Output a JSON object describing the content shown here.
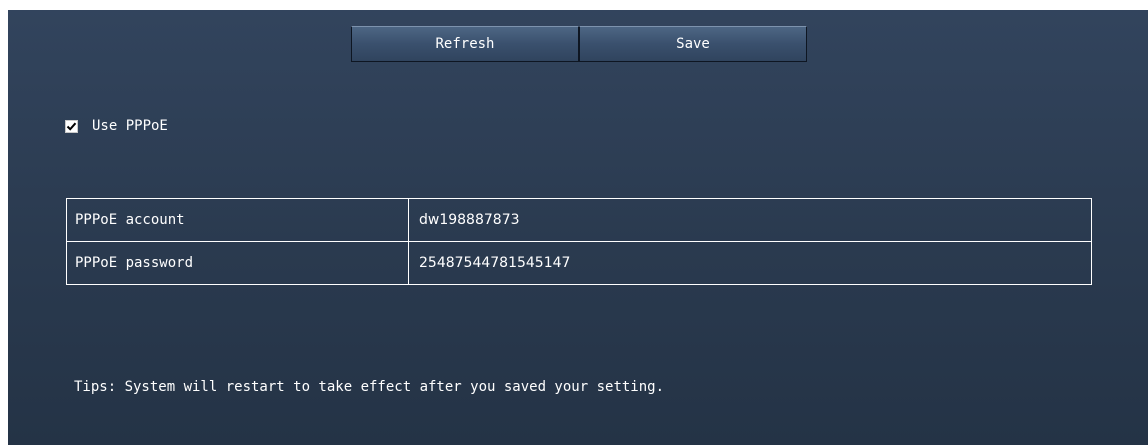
{
  "toolbar": {
    "refresh_label": "Refresh",
    "save_label": "Save"
  },
  "pppoe": {
    "use_label": "Use PPPoE",
    "enabled": true
  },
  "fields": [
    {
      "label": "PPPoE account",
      "value": "dw198887873"
    },
    {
      "label": "PPPoE password",
      "value": "25487544781545147"
    }
  ],
  "tips": "Tips: System will restart to take effect after you saved your setting.",
  "colors": {
    "background": "#2a3a4f",
    "button": "#3a506d",
    "text": "#ffffff"
  }
}
